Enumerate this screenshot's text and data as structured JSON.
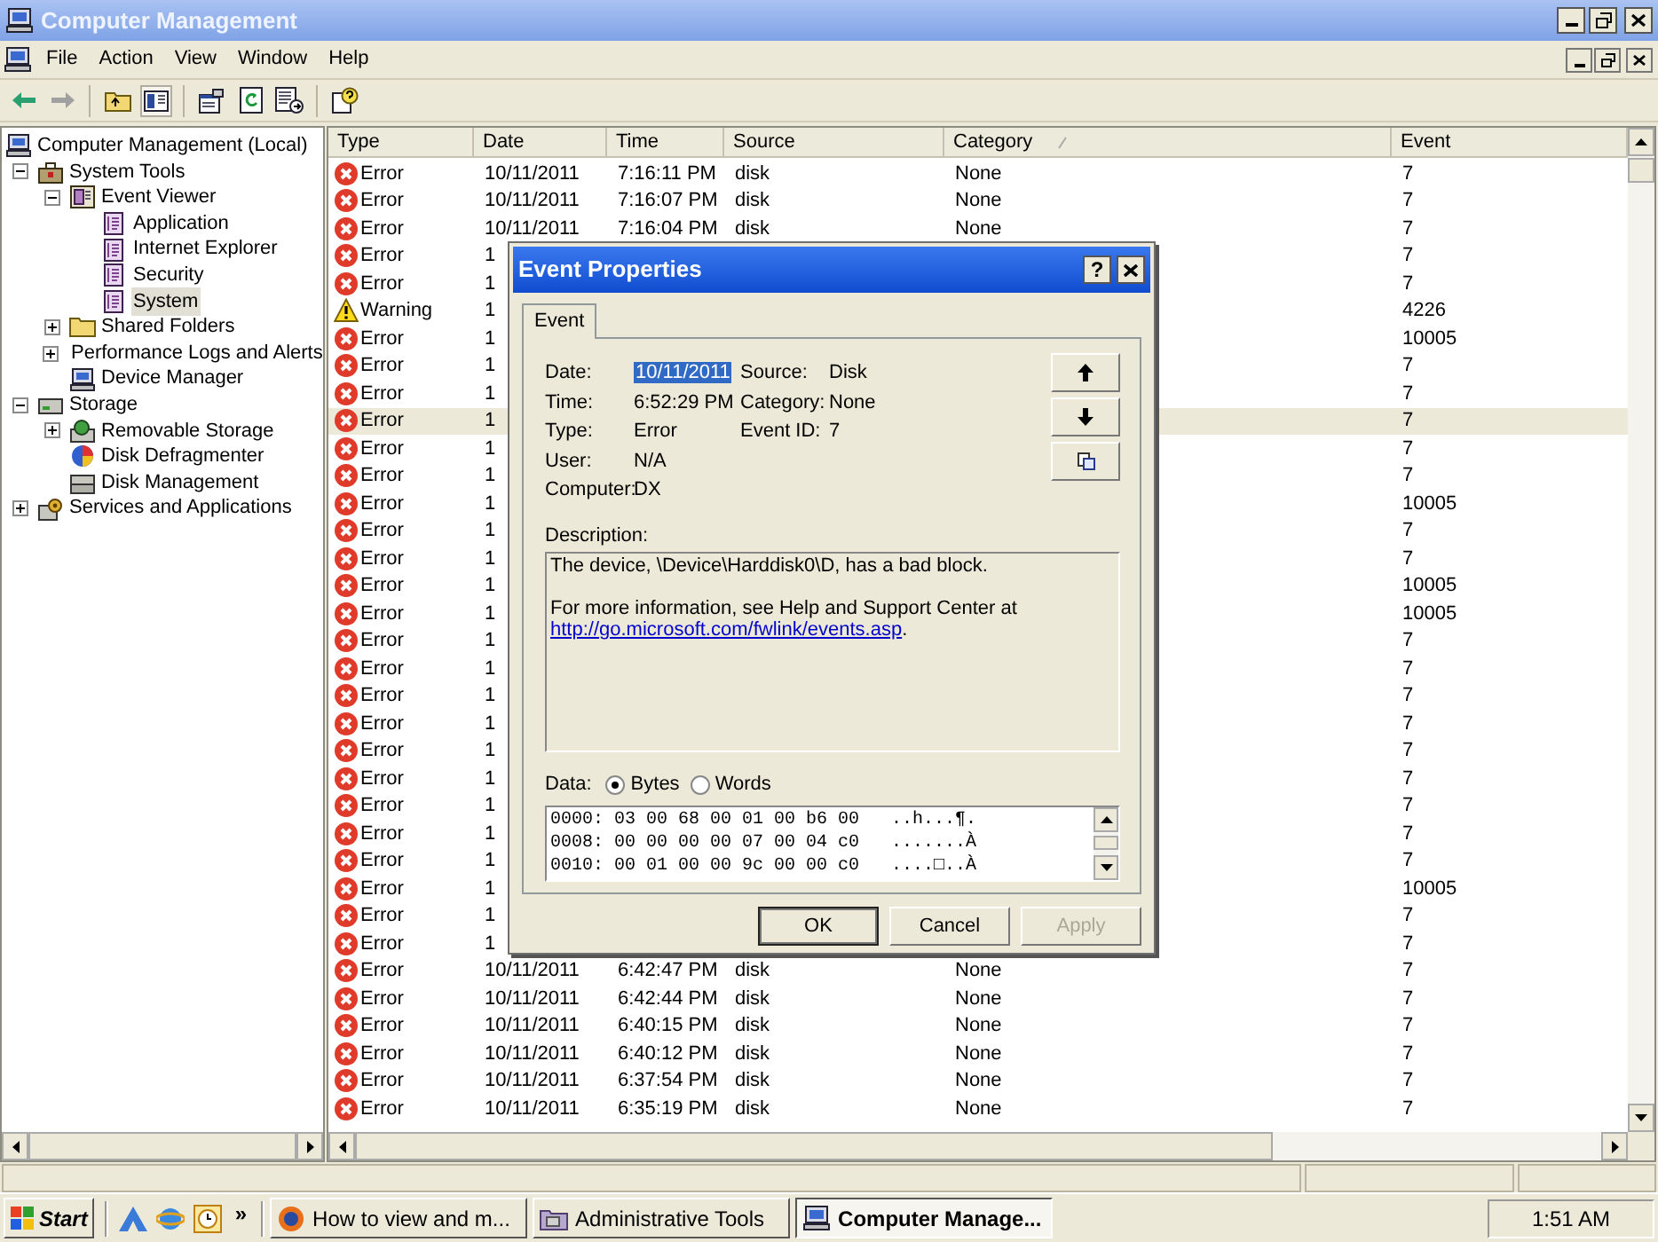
{
  "window": {
    "title": "Computer Management"
  },
  "menu": [
    "File",
    "Action",
    "View",
    "Window",
    "Help"
  ],
  "tree": [
    {
      "label": "Computer Management (Local)",
      "kind": "computer",
      "selected": false,
      "children": [
        {
          "label": "System Tools",
          "kind": "tools",
          "selected": false,
          "expanded": true,
          "children": [
            {
              "label": "Event Viewer",
              "kind": "viewer",
              "selected": false,
              "expanded": true,
              "children": [
                {
                  "label": "Application",
                  "kind": "log",
                  "selected": false
                },
                {
                  "label": "Internet Explorer",
                  "kind": "log",
                  "selected": false
                },
                {
                  "label": "Security",
                  "kind": "log",
                  "selected": false
                },
                {
                  "label": "System",
                  "kind": "log",
                  "selected": true
                }
              ]
            },
            {
              "label": "Shared Folders",
              "kind": "folder",
              "selected": false,
              "expanded": false
            },
            {
              "label": "Performance Logs and Alerts",
              "kind": "performance",
              "selected": false,
              "expanded": false
            },
            {
              "label": "Device Manager",
              "kind": "computer",
              "selected": false
            }
          ]
        },
        {
          "label": "Storage",
          "kind": "storage",
          "selected": false,
          "expanded": true,
          "children": [
            {
              "label": "Removable Storage",
              "kind": "removable",
              "selected": false,
              "expanded": false
            },
            {
              "label": "Disk Defragmenter",
              "kind": "defrag",
              "selected": false
            },
            {
              "label": "Disk Management",
              "kind": "disk",
              "selected": false
            }
          ]
        },
        {
          "label": "Services and Applications",
          "kind": "services",
          "selected": false,
          "expanded": false
        }
      ]
    }
  ],
  "table": {
    "columns": [
      {
        "label": "Type",
        "sorted": false
      },
      {
        "label": "Date",
        "sorted": false
      },
      {
        "label": "Time",
        "sorted": false
      },
      {
        "label": "Source",
        "sorted": false
      },
      {
        "label": "Category",
        "sorted": true
      },
      {
        "label": "Event",
        "sorted": false
      }
    ],
    "rows": [
      {
        "kind": "error",
        "type": "Error",
        "date": "10/11/2011",
        "time": "7:16:11 PM",
        "source": "disk",
        "category": "None",
        "event": "7",
        "selected": false
      },
      {
        "kind": "error",
        "type": "Error",
        "date": "10/11/2011",
        "time": "7:16:07 PM",
        "source": "disk",
        "category": "None",
        "event": "7",
        "selected": false
      },
      {
        "kind": "error",
        "type": "Error",
        "date": "10/11/2011",
        "time": "7:16:04 PM",
        "source": "disk",
        "category": "None",
        "event": "7",
        "selected": false
      },
      {
        "kind": "error",
        "type": "Error",
        "date": "1",
        "event": "7",
        "selected": false
      },
      {
        "kind": "error",
        "type": "Error",
        "date": "1",
        "event": "7",
        "selected": false
      },
      {
        "kind": "warning",
        "type": "Warning",
        "date": "1",
        "event": "4226",
        "selected": false
      },
      {
        "kind": "error",
        "type": "Error",
        "date": "1",
        "event": "10005",
        "selected": false
      },
      {
        "kind": "error",
        "type": "Error",
        "date": "1",
        "event": "7",
        "selected": false
      },
      {
        "kind": "error",
        "type": "Error",
        "date": "1",
        "event": "7",
        "selected": false
      },
      {
        "kind": "error",
        "type": "Error",
        "date": "1",
        "event": "7",
        "selected": true
      },
      {
        "kind": "error",
        "type": "Error",
        "date": "1",
        "event": "7",
        "selected": false
      },
      {
        "kind": "error",
        "type": "Error",
        "date": "1",
        "event": "7",
        "selected": false
      },
      {
        "kind": "error",
        "type": "Error",
        "date": "1",
        "event": "10005",
        "selected": false
      },
      {
        "kind": "error",
        "type": "Error",
        "date": "1",
        "event": "7",
        "selected": false
      },
      {
        "kind": "error",
        "type": "Error",
        "date": "1",
        "event": "7",
        "selected": false
      },
      {
        "kind": "error",
        "type": "Error",
        "date": "1",
        "event": "10005",
        "selected": false
      },
      {
        "kind": "error",
        "type": "Error",
        "date": "1",
        "event": "10005",
        "selected": false
      },
      {
        "kind": "error",
        "type": "Error",
        "date": "1",
        "event": "7",
        "selected": false
      },
      {
        "kind": "error",
        "type": "Error",
        "date": "1",
        "event": "7",
        "selected": false
      },
      {
        "kind": "error",
        "type": "Error",
        "date": "1",
        "event": "7",
        "selected": false
      },
      {
        "kind": "error",
        "type": "Error",
        "date": "1",
        "event": "7",
        "selected": false
      },
      {
        "kind": "error",
        "type": "Error",
        "date": "1",
        "event": "7",
        "selected": false
      },
      {
        "kind": "error",
        "type": "Error",
        "date": "1",
        "event": "7",
        "selected": false
      },
      {
        "kind": "error",
        "type": "Error",
        "date": "1",
        "event": "7",
        "selected": false
      },
      {
        "kind": "error",
        "type": "Error",
        "date": "1",
        "event": "7",
        "selected": false
      },
      {
        "kind": "error",
        "type": "Error",
        "date": "1",
        "event": "7",
        "selected": false
      },
      {
        "kind": "error",
        "type": "Error",
        "date": "1",
        "event": "10005",
        "selected": false
      },
      {
        "kind": "error",
        "type": "Error",
        "date": "1",
        "event": "7",
        "selected": false
      },
      {
        "kind": "error",
        "type": "Error",
        "date": "1",
        "event": "7",
        "selected": false
      },
      {
        "kind": "error",
        "type": "Error",
        "date": "10/11/2011",
        "time": "6:42:47 PM",
        "source": "disk",
        "category": "None",
        "event": "7",
        "selected": false
      },
      {
        "kind": "error",
        "type": "Error",
        "date": "10/11/2011",
        "time": "6:42:44 PM",
        "source": "disk",
        "category": "None",
        "event": "7",
        "selected": false
      },
      {
        "kind": "error",
        "type": "Error",
        "date": "10/11/2011",
        "time": "6:40:15 PM",
        "source": "disk",
        "category": "None",
        "event": "7",
        "selected": false
      },
      {
        "kind": "error",
        "type": "Error",
        "date": "10/11/2011",
        "time": "6:40:12 PM",
        "source": "disk",
        "category": "None",
        "event": "7",
        "selected": false
      },
      {
        "kind": "error",
        "type": "Error",
        "date": "10/11/2011",
        "time": "6:37:54 PM",
        "source": "disk",
        "category": "None",
        "event": "7",
        "selected": false
      },
      {
        "kind": "error",
        "type": "Error",
        "date": "10/11/2011",
        "time": "6:35:19 PM",
        "source": "disk",
        "category": "None",
        "event": "7",
        "selected": false
      }
    ]
  },
  "dialog": {
    "title": "Event Properties",
    "help": "?",
    "tabs": [
      {
        "label": "Event",
        "selected": true
      }
    ],
    "fields": [
      {
        "label": "Date:",
        "value": "10/11/2011",
        "highlighted": true
      },
      {
        "label": "Time:",
        "value": "6:52:29 PM",
        "highlighted": false
      },
      {
        "label": "Type:",
        "value": "Error",
        "highlighted": false
      },
      {
        "label": "User:",
        "value": "N/A",
        "highlighted": false
      },
      {
        "label": "Computer:",
        "value": "DX",
        "highlighted": false
      }
    ],
    "fields_right": [
      {
        "label": "Source:",
        "value": "Disk"
      },
      {
        "label": "Category:",
        "value": "None"
      },
      {
        "label": "Event ID:",
        "value": "7"
      }
    ],
    "description_label": "Description:",
    "description": {
      "lines": [
        "The device, \\Device\\Harddisk0\\D, has a bad block.",
        "For more information, see Help and Support Center at"
      ],
      "link": "http://go.microsoft.com/fwlink/events.asp",
      "link_suffix": "."
    },
    "data_label": "Data:",
    "data_format": [
      {
        "label": "Bytes",
        "selected": true
      },
      {
        "label": "Words",
        "selected": false
      }
    ],
    "data_lines": [
      "0000: 03 00 68 00 01 00 b6 00   ..h...¶.",
      "0008: 00 00 00 00 07 00 04 c0   .......À",
      "0010: 00 01 00 00 9c 00 00 c0   ....□..À"
    ],
    "buttons": [
      {
        "label": "OK",
        "disabled": false,
        "default": true
      },
      {
        "label": "Cancel",
        "disabled": false,
        "default": false
      },
      {
        "label": "Apply",
        "disabled": true,
        "default": false
      }
    ]
  },
  "taskbar": {
    "start": "Start",
    "more": "»",
    "tasks": [
      {
        "label": "How to view and m...",
        "kind": "browser",
        "selected": false
      },
      {
        "label": "Administrative Tools",
        "kind": "tools",
        "selected": false
      },
      {
        "label": "Computer Manage...",
        "kind": "computer",
        "selected": true
      }
    ],
    "clock": "1:51 AM"
  }
}
